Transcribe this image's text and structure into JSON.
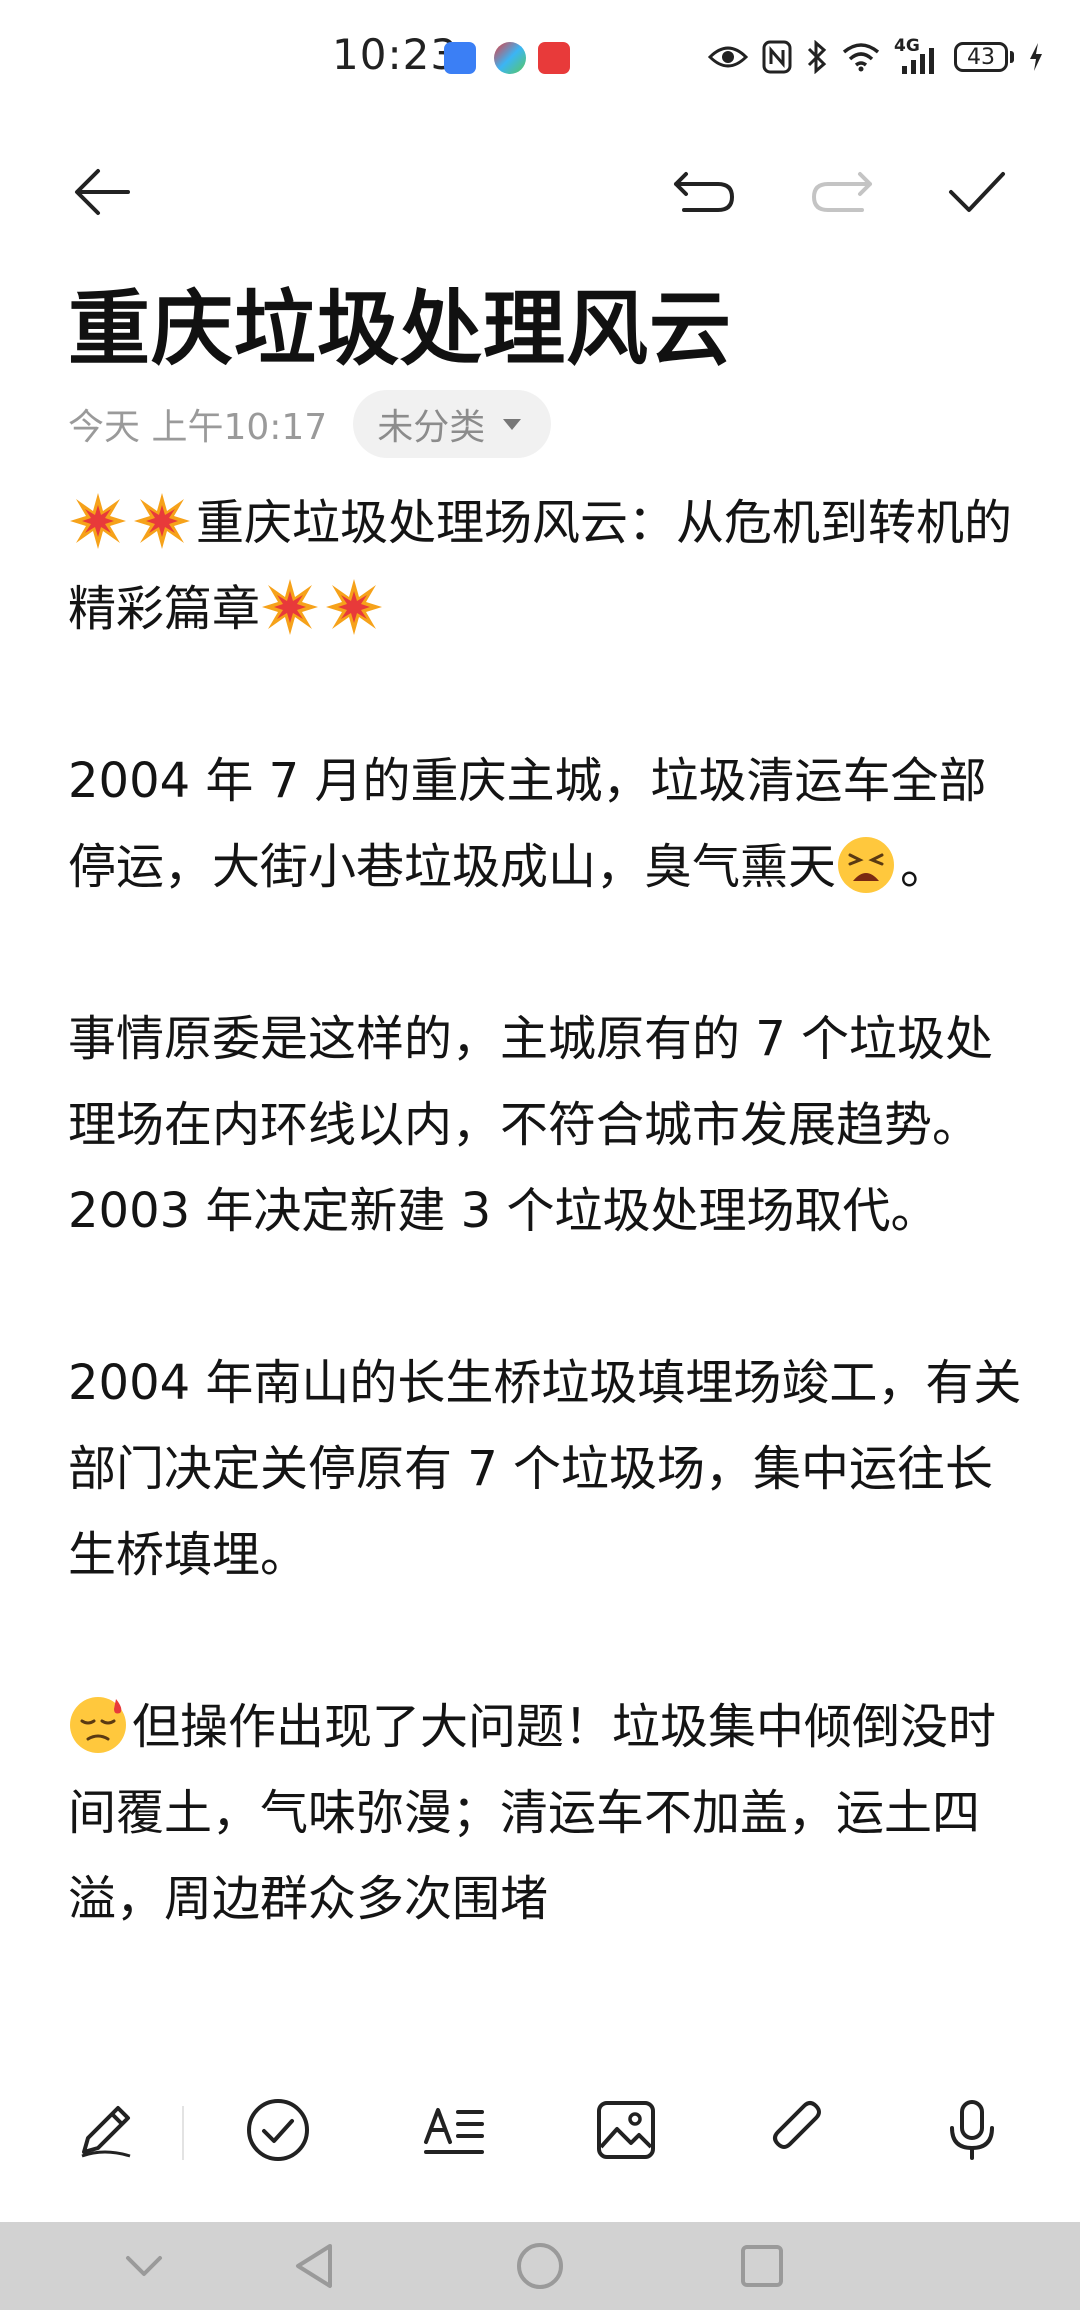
{
  "status_bar": {
    "time": "10:23",
    "network_label": "4G",
    "battery_level": "43"
  },
  "note": {
    "title": "重庆垃圾处理风云",
    "date": "今天 上午10:17",
    "category": "未分类",
    "paragraphs": [
      {
        "emoji_before": [
          "collision",
          "collision"
        ],
        "text": "重庆垃圾处理场风云：从危机到转机的精彩篇章",
        "emoji_after": [
          "collision",
          "collision"
        ]
      },
      {
        "emoji_before": [],
        "text": "2004 年 7 月的重庆主城，垃圾清运车全部停运，大街小巷垃圾成山，臭气熏天",
        "emoji_after": [
          "tired-face"
        ],
        "tail": "。"
      },
      {
        "emoji_before": [],
        "text": "事情原委是这样的，主城原有的 7 个垃圾处理场在内环线以内，不符合城市发展趋势。2003 年决定新建 3 个垃圾处理场取代。",
        "emoji_after": []
      },
      {
        "emoji_before": [],
        "text": "2004 年南山的长生桥垃圾填埋场竣工，有关部门决定关停原有 7 个垃圾场，集中运往长生桥填埋。",
        "emoji_after": []
      },
      {
        "emoji_before": [
          "downcast-sweat"
        ],
        "text": "但操作出现了大问题！垃圾集中倾倒没时间覆土，气味弥漫；清运车不加盖，运土四溢，周边群众多次围堵",
        "emoji_after": []
      }
    ]
  },
  "colors": {
    "accent_red": "#e83a3a",
    "emoji_orange": "#f6a21a",
    "emoji_yellow": "#ffc83d"
  },
  "toolbar_icons": [
    "back-arrow-icon",
    "undo-icon",
    "redo-icon",
    "checkmark-icon"
  ],
  "bottom_tool_icons": [
    "pen-icon",
    "checklist-icon",
    "text-format-icon",
    "image-icon",
    "attachment-icon",
    "microphone-icon"
  ],
  "nav_icons": [
    "chevron-down-icon",
    "back-triangle-icon",
    "home-circle-icon",
    "recents-square-icon"
  ]
}
